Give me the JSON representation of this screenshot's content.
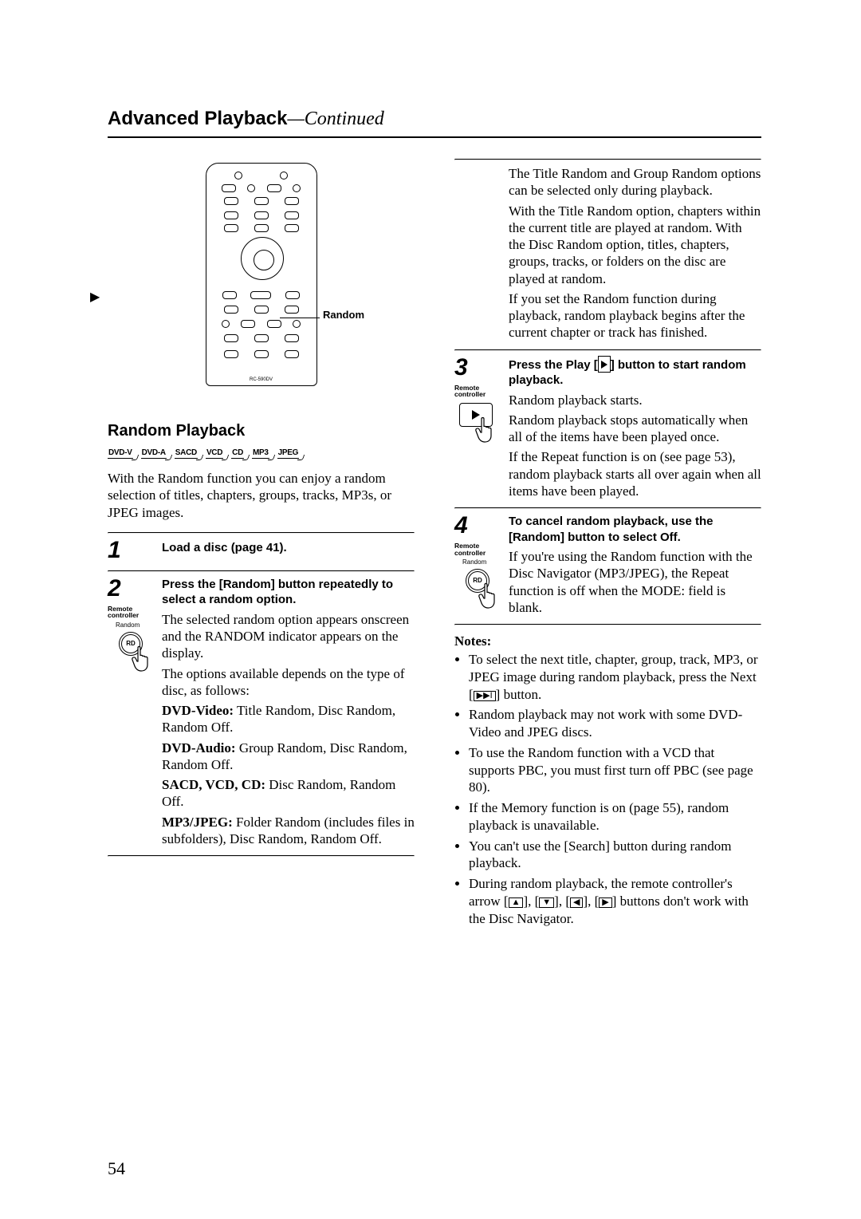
{
  "header": {
    "title": "Advanced Playback",
    "suffix": "—Continued"
  },
  "remote": {
    "model": "RC-590DV",
    "callout_label": "Random",
    "arrow_left": "▶"
  },
  "section": {
    "title": "Random Playback"
  },
  "disc_icons": [
    "DVD-V",
    "DVD-A",
    "SACD",
    "VCD",
    "CD",
    "MP3",
    "JPEG"
  ],
  "intro": "With the Random function you can enjoy a random selection of titles, chapters, groups, tracks, MP3s, or JPEG images.",
  "steps": {
    "s1": {
      "num": "1",
      "lead": "Load a disc (page 41)."
    },
    "s2": {
      "num": "2",
      "sub": "Remote controller",
      "btn_label": "Random",
      "btn_inner": "RD",
      "lead": "Press the [Random] button repeatedly to select a random option.",
      "p1": "The selected random option appears onscreen and the RANDOM indicator appears on the display.",
      "p2": "The options available depends on the type of disc, as follows:",
      "opt_a_l": "DVD-Video:",
      "opt_a_t": " Title Random, Disc Random, Random Off.",
      "opt_b_l": "DVD-Audio:",
      "opt_b_t": " Group Random, Disc Random, Random Off.",
      "opt_c_l": "SACD, VCD, CD:",
      "opt_c_t": " Disc Random, Random Off.",
      "opt_d_l": "MP3/JPEG:",
      "opt_d_t": " Folder Random (includes files in subfolders), Disc Random, Random Off."
    },
    "s2b": {
      "p1": "The Title Random and Group Random options can be selected only during playback.",
      "p2": "With the Title Random option, chapters within the current title are played at random. With the Disc Random option, titles, chapters, groups, tracks, or folders on the disc are played at random.",
      "p3": "If you set the Random function during playback, random playback begins after the current chapter or track has finished."
    },
    "s3": {
      "num": "3",
      "sub": "Remote controller",
      "lead_pre": "Press the Play [",
      "lead_post": "] button to start random playback.",
      "p1": "Random playback starts.",
      "p2": "Random playback stops automatically when all of the items have been played once.",
      "p3": "If the Repeat function is on (see page 53), random playback starts all over again when all items have been played."
    },
    "s4": {
      "num": "4",
      "sub": "Remote controller",
      "btn_label": "Random",
      "btn_inner": "RD",
      "lead": "To cancel random playback, use the [Random] button to select Off.",
      "p1": "If you're using the Random function with the Disc Navigator (MP3/JPEG), the Repeat function is off when the MODE: field is blank."
    }
  },
  "notes": {
    "head": "Notes:",
    "items": [
      {
        "pre": "To select the next title, chapter, group, track, MP3, or JPEG image during random playback, press the Next [",
        "icon": "▶▶I",
        "post": "] button."
      },
      {
        "text": "Random playback may not work with some DVD-Video and JPEG discs."
      },
      {
        "text": "To use the Random function with a VCD that supports PBC, you must first turn off PBC (see page 80)."
      },
      {
        "text": "If the Memory function is on (page 55), random playback is unavailable."
      },
      {
        "text": "You can't use the [Search] button during random playback."
      },
      {
        "pre": "During random playback, the remote controller's arrow [",
        "a1": "▲",
        "m1": "], [",
        "a2": "▼",
        "m2": "], [",
        "a3": "◀",
        "m3": "], [",
        "a4": "▶",
        "post": "] buttons don't work with the Disc Navigator."
      }
    ]
  },
  "page_number": "54"
}
